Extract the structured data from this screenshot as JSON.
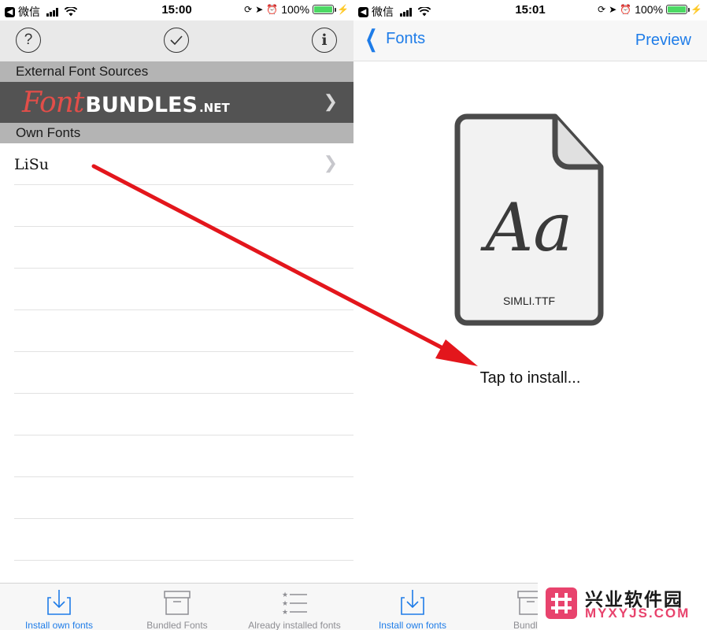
{
  "colors": {
    "accent_blue": "#1e7ce8",
    "section_header_bg": "#b4b4b4",
    "bundles_row_bg": "#535353",
    "fontbundles_red": "#e24e49",
    "arrow_red": "#e3161c",
    "battery_green": "#4cd964",
    "watermark_pink": "#e8436d"
  },
  "left_screen": {
    "status_bar": {
      "carrier": "微信",
      "time": "15:00",
      "battery": "100%"
    },
    "toolbar": {
      "help_icon": "question-circle-icon",
      "check_icon": "check-circle-icon",
      "info_icon": "info-circle-icon"
    },
    "external_sources": {
      "header": "External Font Sources",
      "logo": {
        "part1": "Font",
        "part2": "BUNDLES",
        "part3": ".NET"
      }
    },
    "own_fonts": {
      "header": "Own Fonts",
      "items": [
        "LiSu"
      ]
    },
    "tab_bar": [
      {
        "label": "Install own fonts",
        "icon": "download-tray-icon",
        "active": true
      },
      {
        "label": "Bundled Fonts",
        "icon": "archive-box-icon",
        "active": false
      },
      {
        "label": "Already installed fonts",
        "icon": "star-list-icon",
        "active": false
      }
    ]
  },
  "right_screen": {
    "status_bar": {
      "carrier": "微信",
      "time": "15:01",
      "battery": "100%"
    },
    "nav_bar": {
      "back_label": "Fonts",
      "action_label": "Preview"
    },
    "file_preview": {
      "glyph": "Aa",
      "file_name": "SIMLI.TTF"
    },
    "install_hint": "Tap to install...",
    "tab_bar": [
      {
        "label": "Install own fonts",
        "icon": "download-tray-icon",
        "active": true
      },
      {
        "label": "Bundled",
        "icon": "archive-box-icon",
        "active": false
      }
    ]
  },
  "watermark": {
    "name_cn": "兴业软件园",
    "domain": "MYXYJS.COM"
  }
}
